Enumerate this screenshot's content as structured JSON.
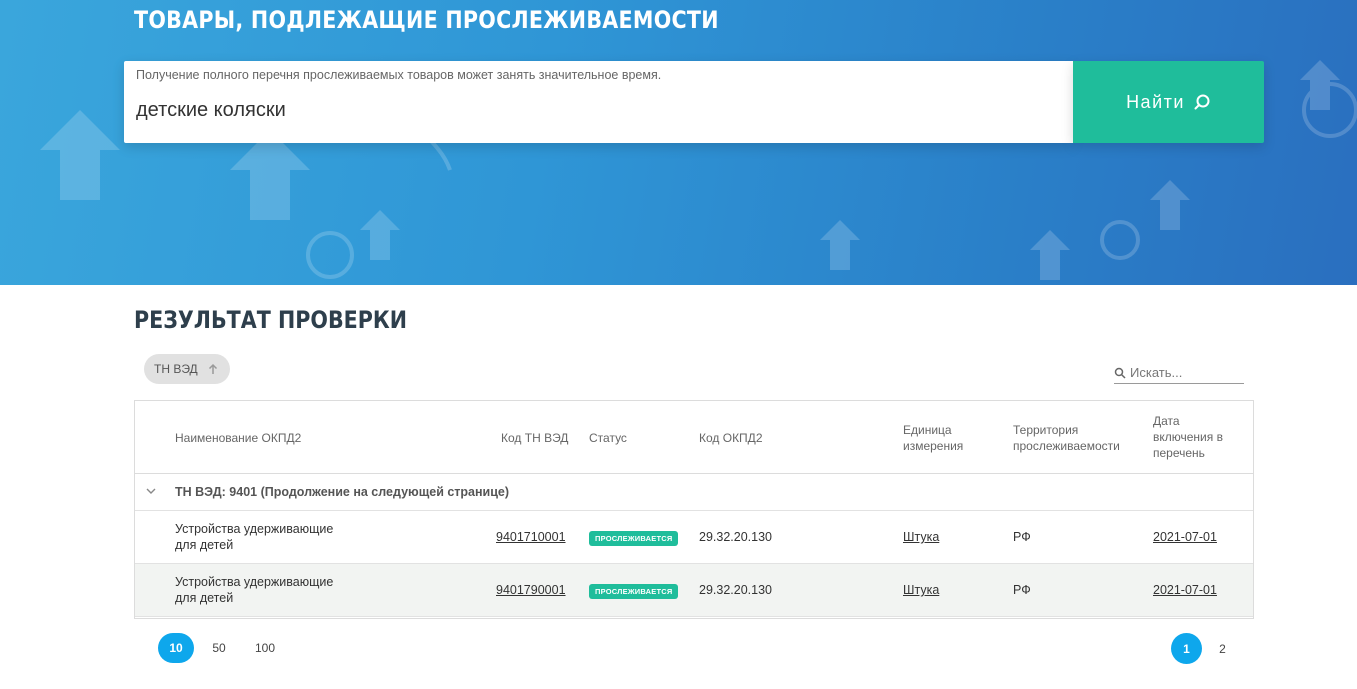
{
  "hero": {
    "title": "ТОВАРЫ, ПОДЛЕЖАЩИЕ ПРОСЛЕЖИВАЕМОСТИ",
    "search_hint": "Получение полного перечня прослеживаемых товаров может занять значительное время.",
    "search_value": "детские коляски",
    "search_button": "Найти"
  },
  "results": {
    "title": "РЕЗУЛЬТАТ ПРОВЕРКИ",
    "sort_chip": "ТН ВЭД",
    "filter_placeholder": "Искать...",
    "columns": {
      "name": "Наименование ОКПД2",
      "tnved": "Код ТН ВЭД",
      "status": "Статус",
      "okpd": "Код ОКПД2",
      "unit_1": "Единица",
      "unit_2": "измерения",
      "territory_1": "Территория",
      "territory_2": "прослеживаемости",
      "date_1": "Дата",
      "date_2": "включения в",
      "date_3": "перечень"
    },
    "group_label": "ТН ВЭД: 9401 (Продолжение на следующей странице)",
    "rows": [
      {
        "name_1": "Устройства удерживающие",
        "name_2": "для детей",
        "tnved": "9401710001",
        "status": "ПРОСЛЕЖИВАЕТСЯ",
        "okpd": "29.32.20.130",
        "unit": "Штука",
        "territory": "РФ",
        "date": "2021-07-01"
      },
      {
        "name_1": "Устройства удерживающие",
        "name_2": "для детей",
        "tnved": "9401790001",
        "status": "ПРОСЛЕЖИВАЕТСЯ",
        "okpd": "29.32.20.130",
        "unit": "Штука",
        "territory": "РФ",
        "date": "2021-07-01"
      }
    ]
  },
  "pagination": {
    "page_sizes": [
      "10",
      "50",
      "100"
    ],
    "active_page_size": "10",
    "pages": [
      "1",
      "2"
    ],
    "active_page": "1"
  },
  "colors": {
    "accent_green": "#1fbd9b",
    "accent_blue": "#0ea7ec",
    "hero_blue": "#2f96d6"
  }
}
